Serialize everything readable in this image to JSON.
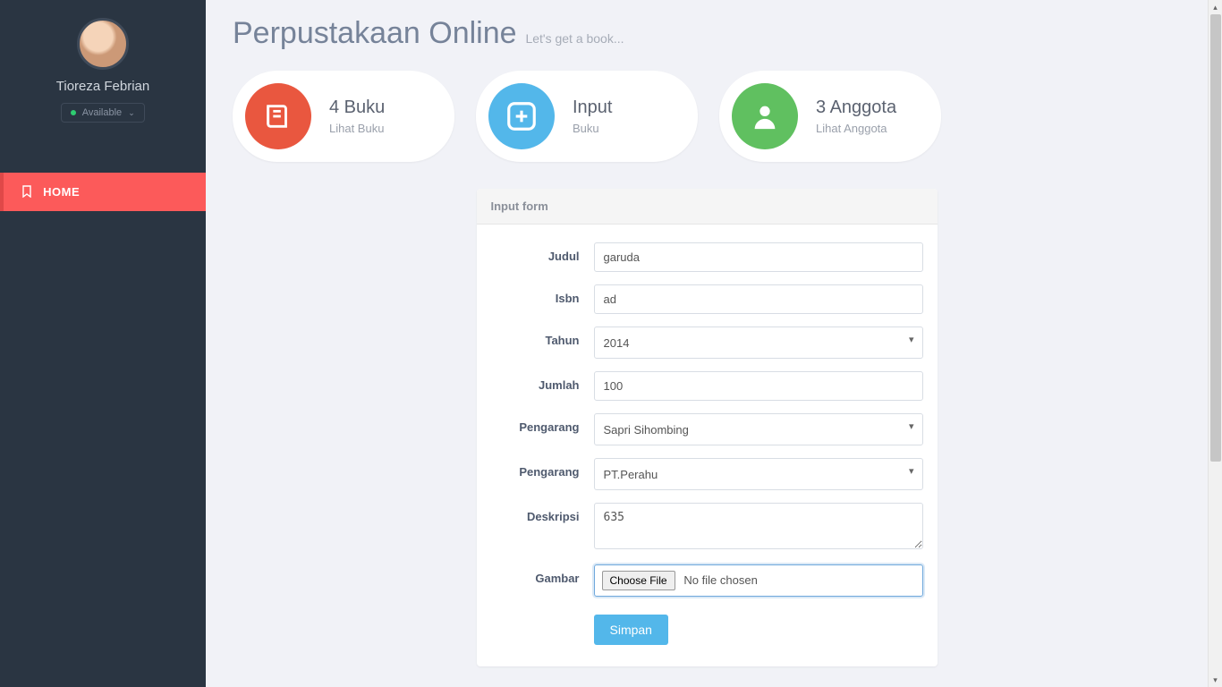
{
  "sidebar": {
    "profile": {
      "name": "Tioreza Febrian",
      "status": "Available"
    },
    "nav": {
      "home": "HOME"
    }
  },
  "header": {
    "title": "Perpustakaan Online",
    "subtitle": "Let's get a book..."
  },
  "cards": {
    "buku": {
      "title": "4 Buku",
      "subtitle": "Lihat Buku"
    },
    "input": {
      "title": "Input",
      "subtitle": "Buku"
    },
    "anggota": {
      "title": "3 Anggota",
      "subtitle": "Lihat Anggota"
    }
  },
  "form": {
    "panel_title": "Input form",
    "labels": {
      "judul": "Judul",
      "isbn": "Isbn",
      "tahun": "Tahun",
      "jumlah": "Jumlah",
      "pengarang": "Pengarang",
      "penerbit": "Pengarang",
      "deskripsi": "Deskripsi",
      "gambar": "Gambar"
    },
    "values": {
      "judul": "garuda",
      "isbn": "ad",
      "tahun": "2014",
      "jumlah": "100",
      "pengarang": "Sapri Sihombing",
      "penerbit": "PT.Perahu",
      "deskripsi": "635"
    },
    "file": {
      "button": "Choose File",
      "status": "No file chosen"
    },
    "submit": "Simpan"
  }
}
